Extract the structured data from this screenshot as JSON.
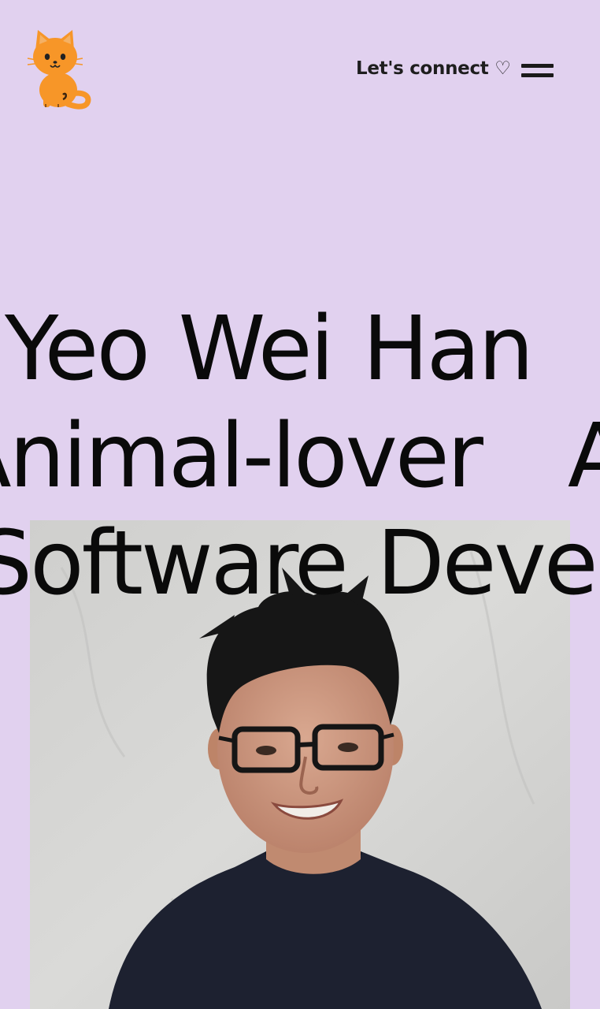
{
  "header": {
    "logo_icon": "cat-emoji-icon",
    "connect_label": "Let's connect ♡",
    "menu_icon": "hamburger-menu-icon"
  },
  "hero": {
    "lines": [
      "Yeo Wei Han",
      "Animal-lover",
      "Software Developer"
    ],
    "row1": {
      "text": "Yeo Wei Han"
    },
    "row2": {
      "text_a": "Animal-lover",
      "text_b": "Animal-lover"
    },
    "row3": {
      "text": "Software Developer"
    }
  },
  "photo": {
    "subject": "portrait-photo"
  },
  "colors": {
    "background": "#e1d1ef",
    "text": "#0a0a0a",
    "logo_orange": "#f79628"
  }
}
